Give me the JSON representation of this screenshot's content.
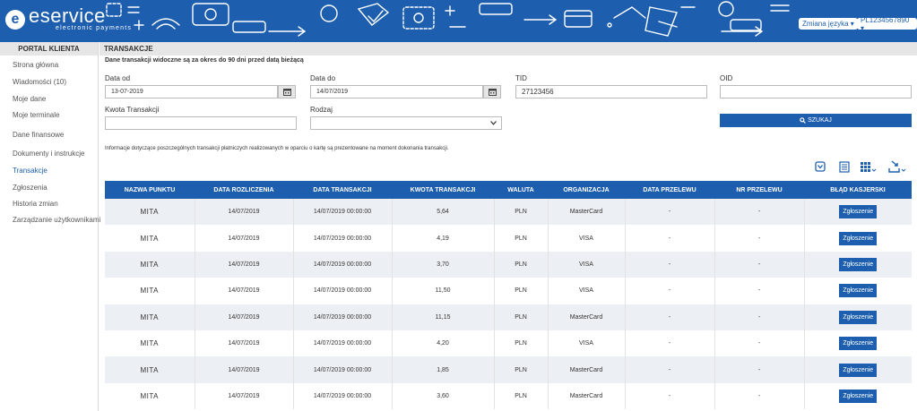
{
  "brand": {
    "name": "eservice",
    "tagline": "electronic payments",
    "color": "#1d5fae"
  },
  "header": {
    "language_button": "Zmiana języka ▾",
    "account_button": "PL1234567890 ▾"
  },
  "sidebar": {
    "title": "PORTAL KLIENTA",
    "items": [
      {
        "label": "Strona główna",
        "name": "sidebar-item-home"
      },
      {
        "label": "Wiadomości (10)",
        "name": "sidebar-item-messages"
      },
      {
        "label": "Moje dane",
        "name": "sidebar-item-my-data"
      },
      {
        "label": "Moje terminale",
        "name": "sidebar-item-my-terminals"
      },
      {
        "label": "Dane finansowe",
        "name": "sidebar-item-financial-data"
      },
      {
        "label": "Dokumenty i instrukcje",
        "name": "sidebar-item-documents"
      },
      {
        "label": "Transakcje",
        "name": "sidebar-item-transactions",
        "active": true
      },
      {
        "label": "Zgłoszenia",
        "name": "sidebar-item-tickets"
      },
      {
        "label": "Historia zmian",
        "name": "sidebar-item-change-history"
      },
      {
        "label": "Zarządzanie użytkownikami",
        "name": "sidebar-item-user-management"
      }
    ]
  },
  "main": {
    "title": "TRANSAKCJE",
    "note_range": "Dane transakcji widoczne są za okres do 90 dni przed datą bieżącą",
    "filters": {
      "date_from": {
        "label": "Data od",
        "value": "13-07-2019"
      },
      "date_to": {
        "label": "Data do",
        "value": "14/07/2019"
      },
      "tid": {
        "label": "TID",
        "value": "27123456"
      },
      "oid": {
        "label": "OID",
        "value": ""
      },
      "amount": {
        "label": "Kwota Transakcji",
        "value": ""
      },
      "type": {
        "label": "Rodzaj",
        "value": ""
      },
      "search_label": "SZUKAJ"
    },
    "note_info": "Informacje dotyczące poszczególnych transakcji płatniczych realizowanych w oparciu o kartę są prezentowane na moment dokonania transakcji."
  },
  "table": {
    "headers": [
      "NAZWA PUNKTU",
      "DATA ROZLICZENIA",
      "DATA TRANSAKCJI",
      "KWOTA TRANSAKCJI",
      "WALUTA",
      "ORGANIZACJA",
      "DATA PRZELEWU",
      "NR PRZELEWU",
      "BŁĄD KASJERSKI"
    ],
    "rows": [
      [
        "MITA",
        "14/07/2019",
        "14/07/2019 00:00:00",
        "5,64",
        "PLN",
        "MasterCard",
        "-",
        "-",
        "Zgłoszenie"
      ],
      [
        "MITA",
        "14/07/2019",
        "14/07/2019 00:00:00",
        "4,19",
        "PLN",
        "VISA",
        "-",
        "-",
        "Zgłoszenie"
      ],
      [
        "MITA",
        "14/07/2019",
        "14/07/2019 00:00:00",
        "3,70",
        "PLN",
        "VISA",
        "-",
        "-",
        "Zgłoszenie"
      ],
      [
        "MITA",
        "14/07/2019",
        "14/07/2019 00:00:00",
        "11,50",
        "PLN",
        "VISA",
        "-",
        "-",
        "Zgłoszenie"
      ],
      [
        "MITA",
        "14/07/2019",
        "14/07/2019 00:00:00",
        "11,15",
        "PLN",
        "MasterCard",
        "-",
        "-",
        "Zgłoszenie"
      ],
      [
        "MITA",
        "14/07/2019",
        "14/07/2019 00:00:00",
        "4,20",
        "PLN",
        "VISA",
        "-",
        "-",
        "Zgłoszenie"
      ],
      [
        "MITA",
        "14/07/2019",
        "14/07/2019 00:00:00",
        "1,85",
        "PLN",
        "MasterCard",
        "-",
        "-",
        "Zgłoszenie"
      ],
      [
        "MITA",
        "14/07/2019",
        "14/07/2019 00:00:00",
        "3,60",
        "PLN",
        "MasterCard",
        "-",
        "-",
        "Zgłoszenie"
      ]
    ]
  },
  "icons": [
    "calendar-icon",
    "chevron-down-icon",
    "search-icon",
    "collapse-icon",
    "list-view-icon",
    "grid-view-icon",
    "export-icon"
  ]
}
